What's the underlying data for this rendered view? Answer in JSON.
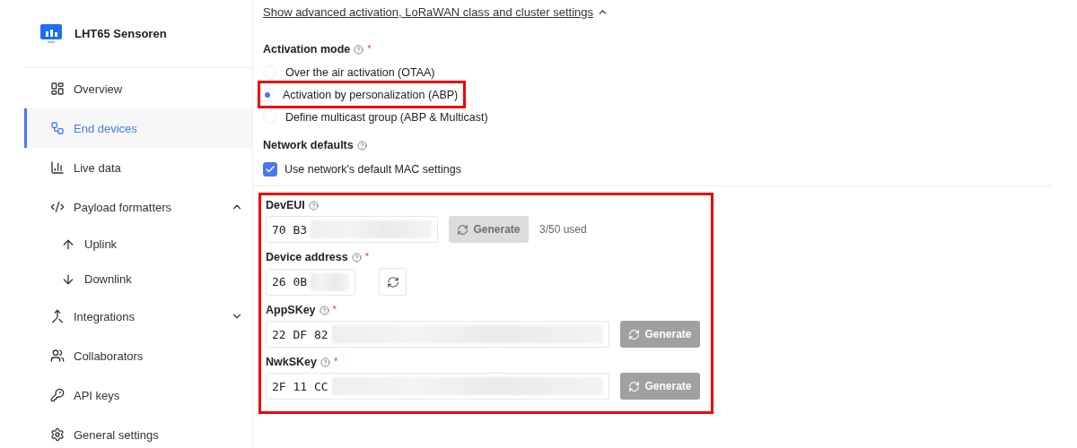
{
  "sidebar": {
    "app_title": "LHT65 Sensoren",
    "items": [
      {
        "kind": "overview",
        "label": "Overview",
        "selected": false
      },
      {
        "kind": "devices",
        "label": "End devices",
        "selected": true
      },
      {
        "kind": "live",
        "label": "Live data",
        "selected": false
      },
      {
        "kind": "code",
        "label": "Payload formatters",
        "selected": false,
        "expanded": true,
        "children": [
          {
            "kind": "up",
            "label": "Uplink",
            "selected": false
          },
          {
            "kind": "down",
            "label": "Downlink",
            "selected": false
          }
        ]
      },
      {
        "kind": "integrations",
        "label": "Integrations",
        "selected": false,
        "expanded": false
      },
      {
        "kind": "people",
        "label": "Collaborators",
        "selected": false
      },
      {
        "kind": "key",
        "label": "API keys",
        "selected": false
      },
      {
        "kind": "gear",
        "label": "General settings",
        "selected": false
      }
    ]
  },
  "advanced_toggle": {
    "label": "Show advanced activation, LoRaWAN class and cluster settings",
    "expanded": true
  },
  "activation_mode": {
    "label": "Activation mode",
    "required_mark": "*",
    "options": [
      {
        "label": "Over the air activation (OTAA)",
        "selected": false,
        "highlighted": false
      },
      {
        "label": "Activation by personalization (ABP)",
        "selected": true,
        "highlighted": true
      },
      {
        "label": "Define multicast group (ABP & Multicast)",
        "selected": false,
        "highlighted": false
      }
    ]
  },
  "network_defaults": {
    "label": "Network defaults",
    "checkbox": {
      "label": "Use network's default MAC settings",
      "checked": true
    }
  },
  "keys_section": {
    "highlighted": true,
    "fields": [
      {
        "kind": "wide_button",
        "label": "DevEUI",
        "value": "70 B3",
        "redacted": true,
        "button": "Generate",
        "button_disabled": true,
        "note": "3/50 used"
      },
      {
        "kind": "icon_button",
        "label": "Device address",
        "required_mark": "*",
        "value": "26 0B",
        "redacted": true
      },
      {
        "kind": "long",
        "label": "AppSKey",
        "required_mark": "*",
        "value": "22 DF 82",
        "redacted": true,
        "button": "Generate",
        "button_disabled": false
      },
      {
        "kind": "long",
        "label": "NwkSKey",
        "required_mark": "*",
        "value": "2F 11 CC",
        "redacted": true,
        "button": "Generate",
        "button_disabled": false
      }
    ]
  }
}
